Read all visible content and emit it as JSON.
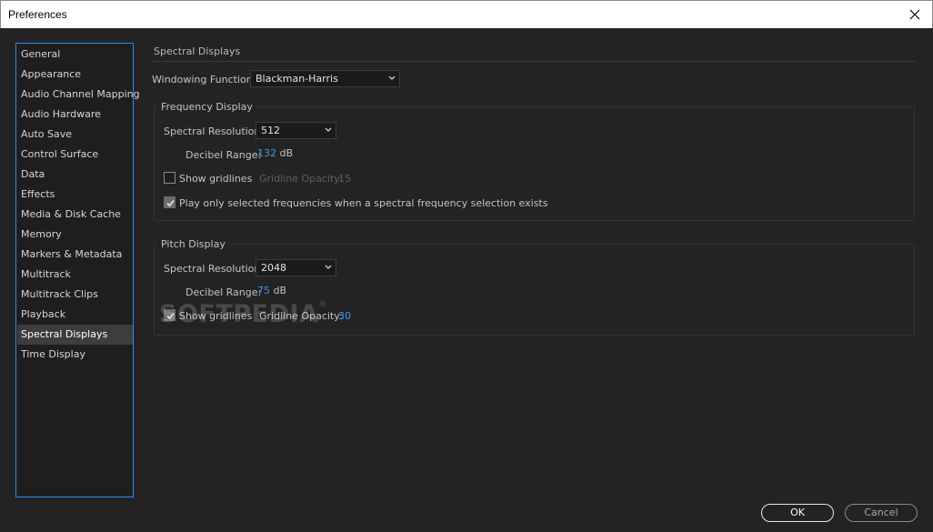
{
  "window": {
    "title": "Preferences"
  },
  "sidebar": {
    "items": [
      {
        "label": "General"
      },
      {
        "label": "Appearance"
      },
      {
        "label": "Audio Channel Mapping"
      },
      {
        "label": "Audio Hardware"
      },
      {
        "label": "Auto Save"
      },
      {
        "label": "Control Surface"
      },
      {
        "label": "Data"
      },
      {
        "label": "Effects"
      },
      {
        "label": "Media & Disk Cache"
      },
      {
        "label": "Memory"
      },
      {
        "label": "Markers & Metadata"
      },
      {
        "label": "Multitrack"
      },
      {
        "label": "Multitrack Clips"
      },
      {
        "label": "Playback"
      },
      {
        "label": "Spectral Displays",
        "active": true
      },
      {
        "label": "Time Display"
      }
    ]
  },
  "main": {
    "title": "Spectral Displays",
    "windowing": {
      "label": "Windowing Function:",
      "value": "Blackman-Harris"
    },
    "frequency": {
      "title": "Frequency Display",
      "resolution_label": "Spectral Resolution:",
      "resolution_value": "512",
      "decibel_label": "Decibel Range:",
      "decibel_value": "132",
      "decibel_unit": "dB",
      "gridlines_label": "Show gridlines",
      "gridlines_checked": false,
      "opacity_label": "Gridline Opacity:",
      "opacity_value": "15",
      "play_label": "Play only selected frequencies when a spectral frequency selection exists",
      "play_checked": true
    },
    "pitch": {
      "title": "Pitch Display",
      "resolution_label": "Spectral Resolution:",
      "resolution_value": "2048",
      "decibel_label": "Decibel Range:",
      "decibel_value": "75",
      "decibel_unit": "dB",
      "gridlines_label": "Show gridlines",
      "gridlines_checked": true,
      "opacity_label": "Gridline Opacity:",
      "opacity_value": "30"
    }
  },
  "buttons": {
    "ok": "OK",
    "cancel": "Cancel"
  },
  "watermark": "SOFTPEDIA",
  "colors": {
    "accent": "#2d8ceb",
    "value": "#3c9bf0",
    "background": "#232323"
  }
}
